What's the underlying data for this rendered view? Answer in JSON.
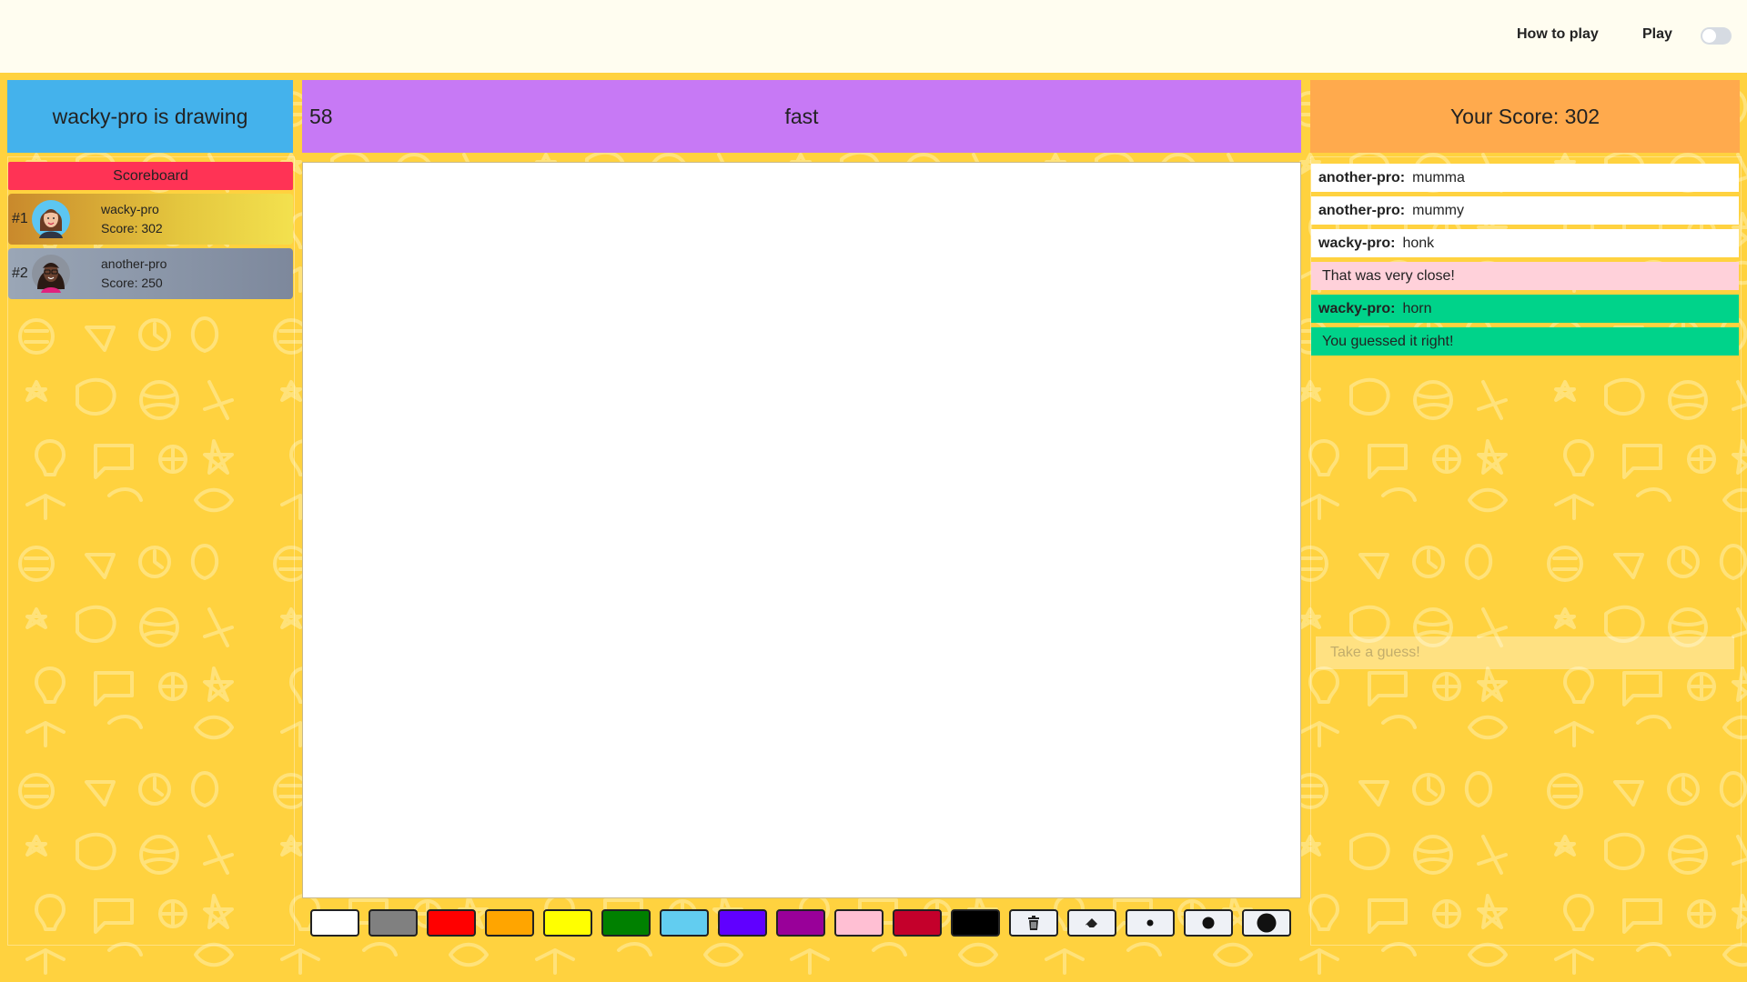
{
  "nav": {
    "how_to_play": "How to play",
    "play": "Play",
    "theme_toggle": "off"
  },
  "game": {
    "drawing_status": "wacky-pro is drawing",
    "timer": "58",
    "word": "fast",
    "your_score": "Your Score: 302"
  },
  "scoreboard": {
    "title": "Scoreboard",
    "players": [
      {
        "rank": "#1",
        "name": "wacky-pro",
        "score": "Score: 302"
      },
      {
        "rank": "#2",
        "name": "another-pro",
        "score": "Score: 250"
      }
    ]
  },
  "chat": {
    "messages": [
      {
        "user": "another-pro:",
        "text": "mumma",
        "type": "guess"
      },
      {
        "user": "another-pro:",
        "text": "mummy",
        "type": "guess"
      },
      {
        "user": "wacky-pro:",
        "text": "honk",
        "type": "guess"
      },
      {
        "user": "",
        "text": "That was very close!",
        "type": "close"
      },
      {
        "user": "wacky-pro:",
        "text": "horn",
        "type": "correct"
      },
      {
        "user": "",
        "text": "You guessed it right!",
        "type": "correct"
      }
    ],
    "input_placeholder": "Take a guess!"
  },
  "palette": {
    "colors": [
      "#ffffff",
      "#808080",
      "#ff0000",
      "#ffa500",
      "#ffff00",
      "#008000",
      "#62cdf0",
      "#6000ff",
      "#990099",
      "#ffbfd3",
      "#c4002b",
      "#000000"
    ]
  },
  "tools": [
    "trash-icon",
    "eraser-icon",
    "brush-small-icon",
    "brush-medium-icon",
    "brush-large-icon"
  ],
  "theme_colors": {
    "background": "#ffd23f",
    "drawing_header": "#44b2ec",
    "word_header": "#c779f5",
    "score_header": "#ffaa4d",
    "scoreboard_title": "#ff3355",
    "correct": "#00d38a",
    "close": "#ffd1da"
  }
}
